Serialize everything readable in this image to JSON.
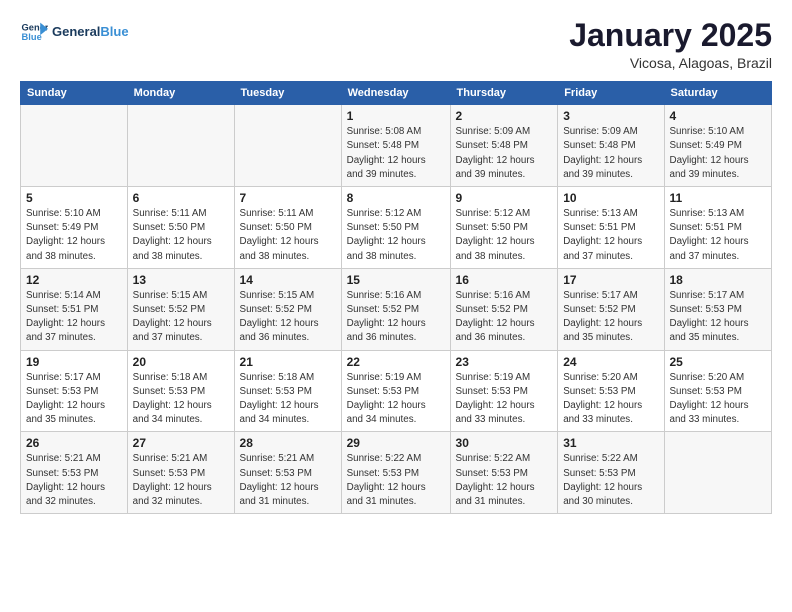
{
  "logo": {
    "line1": "General",
    "line2": "Blue"
  },
  "title": "January 2025",
  "subtitle": "Vicosa, Alagoas, Brazil",
  "days_header": [
    "Sunday",
    "Monday",
    "Tuesday",
    "Wednesday",
    "Thursday",
    "Friday",
    "Saturday"
  ],
  "weeks": [
    [
      {
        "num": "",
        "info": ""
      },
      {
        "num": "",
        "info": ""
      },
      {
        "num": "",
        "info": ""
      },
      {
        "num": "1",
        "info": "Sunrise: 5:08 AM\nSunset: 5:48 PM\nDaylight: 12 hours\nand 39 minutes."
      },
      {
        "num": "2",
        "info": "Sunrise: 5:09 AM\nSunset: 5:48 PM\nDaylight: 12 hours\nand 39 minutes."
      },
      {
        "num": "3",
        "info": "Sunrise: 5:09 AM\nSunset: 5:48 PM\nDaylight: 12 hours\nand 39 minutes."
      },
      {
        "num": "4",
        "info": "Sunrise: 5:10 AM\nSunset: 5:49 PM\nDaylight: 12 hours\nand 39 minutes."
      }
    ],
    [
      {
        "num": "5",
        "info": "Sunrise: 5:10 AM\nSunset: 5:49 PM\nDaylight: 12 hours\nand 38 minutes."
      },
      {
        "num": "6",
        "info": "Sunrise: 5:11 AM\nSunset: 5:50 PM\nDaylight: 12 hours\nand 38 minutes."
      },
      {
        "num": "7",
        "info": "Sunrise: 5:11 AM\nSunset: 5:50 PM\nDaylight: 12 hours\nand 38 minutes."
      },
      {
        "num": "8",
        "info": "Sunrise: 5:12 AM\nSunset: 5:50 PM\nDaylight: 12 hours\nand 38 minutes."
      },
      {
        "num": "9",
        "info": "Sunrise: 5:12 AM\nSunset: 5:50 PM\nDaylight: 12 hours\nand 38 minutes."
      },
      {
        "num": "10",
        "info": "Sunrise: 5:13 AM\nSunset: 5:51 PM\nDaylight: 12 hours\nand 37 minutes."
      },
      {
        "num": "11",
        "info": "Sunrise: 5:13 AM\nSunset: 5:51 PM\nDaylight: 12 hours\nand 37 minutes."
      }
    ],
    [
      {
        "num": "12",
        "info": "Sunrise: 5:14 AM\nSunset: 5:51 PM\nDaylight: 12 hours\nand 37 minutes."
      },
      {
        "num": "13",
        "info": "Sunrise: 5:15 AM\nSunset: 5:52 PM\nDaylight: 12 hours\nand 37 minutes."
      },
      {
        "num": "14",
        "info": "Sunrise: 5:15 AM\nSunset: 5:52 PM\nDaylight: 12 hours\nand 36 minutes."
      },
      {
        "num": "15",
        "info": "Sunrise: 5:16 AM\nSunset: 5:52 PM\nDaylight: 12 hours\nand 36 minutes."
      },
      {
        "num": "16",
        "info": "Sunrise: 5:16 AM\nSunset: 5:52 PM\nDaylight: 12 hours\nand 36 minutes."
      },
      {
        "num": "17",
        "info": "Sunrise: 5:17 AM\nSunset: 5:52 PM\nDaylight: 12 hours\nand 35 minutes."
      },
      {
        "num": "18",
        "info": "Sunrise: 5:17 AM\nSunset: 5:53 PM\nDaylight: 12 hours\nand 35 minutes."
      }
    ],
    [
      {
        "num": "19",
        "info": "Sunrise: 5:17 AM\nSunset: 5:53 PM\nDaylight: 12 hours\nand 35 minutes."
      },
      {
        "num": "20",
        "info": "Sunrise: 5:18 AM\nSunset: 5:53 PM\nDaylight: 12 hours\nand 34 minutes."
      },
      {
        "num": "21",
        "info": "Sunrise: 5:18 AM\nSunset: 5:53 PM\nDaylight: 12 hours\nand 34 minutes."
      },
      {
        "num": "22",
        "info": "Sunrise: 5:19 AM\nSunset: 5:53 PM\nDaylight: 12 hours\nand 34 minutes."
      },
      {
        "num": "23",
        "info": "Sunrise: 5:19 AM\nSunset: 5:53 PM\nDaylight: 12 hours\nand 33 minutes."
      },
      {
        "num": "24",
        "info": "Sunrise: 5:20 AM\nSunset: 5:53 PM\nDaylight: 12 hours\nand 33 minutes."
      },
      {
        "num": "25",
        "info": "Sunrise: 5:20 AM\nSunset: 5:53 PM\nDaylight: 12 hours\nand 33 minutes."
      }
    ],
    [
      {
        "num": "26",
        "info": "Sunrise: 5:21 AM\nSunset: 5:53 PM\nDaylight: 12 hours\nand 32 minutes."
      },
      {
        "num": "27",
        "info": "Sunrise: 5:21 AM\nSunset: 5:53 PM\nDaylight: 12 hours\nand 32 minutes."
      },
      {
        "num": "28",
        "info": "Sunrise: 5:21 AM\nSunset: 5:53 PM\nDaylight: 12 hours\nand 31 minutes."
      },
      {
        "num": "29",
        "info": "Sunrise: 5:22 AM\nSunset: 5:53 PM\nDaylight: 12 hours\nand 31 minutes."
      },
      {
        "num": "30",
        "info": "Sunrise: 5:22 AM\nSunset: 5:53 PM\nDaylight: 12 hours\nand 31 minutes."
      },
      {
        "num": "31",
        "info": "Sunrise: 5:22 AM\nSunset: 5:53 PM\nDaylight: 12 hours\nand 30 minutes."
      },
      {
        "num": "",
        "info": ""
      }
    ]
  ]
}
